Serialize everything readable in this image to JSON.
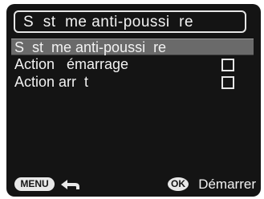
{
  "screen": {
    "title": "S  st  me anti-poussi  re"
  },
  "menu": {
    "items": [
      {
        "label": "S  st  me anti-poussi  re",
        "selected": true
      },
      {
        "label": "Action   émarrage",
        "has_checkbox": true,
        "checked": false
      },
      {
        "label": "Action arr  t",
        "has_checkbox": true,
        "checked": false
      }
    ]
  },
  "bottom_bar": {
    "menu_button_label": "MENU",
    "ok_button_label": "OK",
    "action_label": "Démarrer"
  },
  "colors": {
    "screen_background": "#141414",
    "selected_row": "#6a6a6a",
    "text": "#f2f2f2"
  }
}
